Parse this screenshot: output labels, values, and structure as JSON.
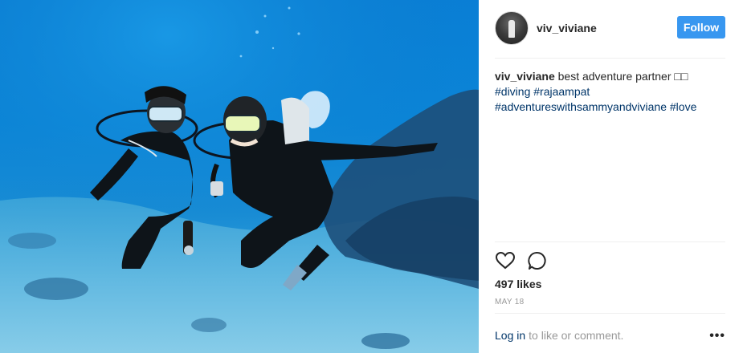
{
  "photo": {
    "alt_subject": "underwater-divers-photo",
    "water_color": "#0a82d8"
  },
  "header": {
    "username": "viv_viviane",
    "follow_label": "Follow",
    "accent_color": "#3897f0"
  },
  "caption": {
    "username": "viv_viviane",
    "text": "best adventure partner □□",
    "hashtags": [
      "#diving",
      "#rajaampat",
      "#adventureswithsammyandviviane",
      "#love"
    ]
  },
  "actions": {
    "icons": [
      "heart-icon",
      "comment-icon"
    ]
  },
  "likes": "497 likes",
  "date": "MAY 18",
  "footer": {
    "login_link": "Log in",
    "login_text": "to like or comment.",
    "more_label": "•••"
  }
}
